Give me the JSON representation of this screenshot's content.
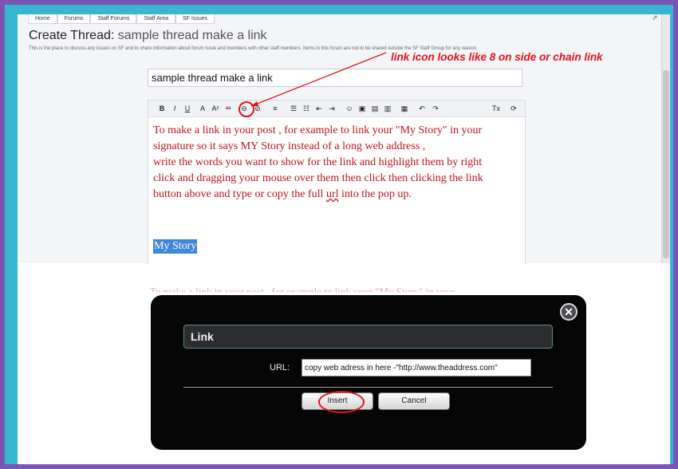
{
  "breadcrumb": [
    "Home",
    "Forums",
    "Staff Forums",
    "Staff Area",
    "SF Issues"
  ],
  "page": {
    "title": "Create Thread:",
    "subtitle": "sample thread make a link",
    "description": "This is the place to discuss any issues on SF and to share information about forum issue and members with other staff members. Items in this forum are not to be shared outside the SF Staff Group for any reason."
  },
  "thread_title_input": {
    "value": "sample thread make a link"
  },
  "editor": {
    "toolbar": [
      {
        "name": "bold-icon",
        "glyph": "B"
      },
      {
        "name": "italic-icon",
        "glyph": "I"
      },
      {
        "name": "underline-icon",
        "glyph": "U"
      },
      {
        "name": "font-color-icon",
        "glyph": "A"
      },
      {
        "name": "font-size-icon",
        "glyph": "A²"
      },
      {
        "name": "font-family-icon",
        "glyph": "ᵃᵃ"
      },
      {
        "name": "link-icon",
        "glyph": "⊖"
      },
      {
        "name": "unlink-icon",
        "glyph": "⊘"
      },
      {
        "name": "align-icon",
        "glyph": "≡"
      },
      {
        "name": "bullet-list-icon",
        "glyph": "☰"
      },
      {
        "name": "numbered-list-icon",
        "glyph": "☷"
      },
      {
        "name": "outdent-icon",
        "glyph": "⇤"
      },
      {
        "name": "indent-icon",
        "glyph": "⇥"
      },
      {
        "name": "smiley-icon",
        "glyph": "☺"
      },
      {
        "name": "image-icon",
        "glyph": "▣"
      },
      {
        "name": "media-icon",
        "glyph": "▤"
      },
      {
        "name": "quote-icon",
        "glyph": "▥"
      },
      {
        "name": "save-draft-icon",
        "glyph": "▦"
      },
      {
        "name": "undo-icon",
        "glyph": "↶"
      },
      {
        "name": "redo-icon",
        "glyph": "↷"
      },
      {
        "name": "remove-format-icon",
        "glyph": "Tx"
      },
      {
        "name": "toggle-bbcode-icon",
        "glyph": "⟳"
      }
    ],
    "body_line_1": "To make a link in your post , for example to link your \"My Story\" in your",
    "body_line_2": "signature so it says MY Story instead of a long web address ,",
    "body_line_3": "write the words you want to show for the link and highlight them by right",
    "body_line_4": "click and dragging your mouse  over them then click then clicking the link",
    "body_line_5_a": "button above and type or copy  the full ",
    "body_line_5_url": "url",
    "body_line_5_b": " into the pop up.",
    "selected_text": "My Story"
  },
  "annotation": "link icon looks like 8 on side or chain link",
  "dialog": {
    "title": "Link",
    "url_label": "URL:",
    "url_value": "copy web adress in here -\"http://www.theaddress.com\"",
    "insert_label": "Insert",
    "cancel_label": "Cancel",
    "close_glyph": "✕"
  },
  "colors": {
    "frame_outer": "#7a55b5",
    "frame_inner": "#36b7cf",
    "editor_text": "#c0121c",
    "annotation": "#e8101c",
    "selection": "#3f87d9",
    "dialog_bg": "#060606"
  }
}
